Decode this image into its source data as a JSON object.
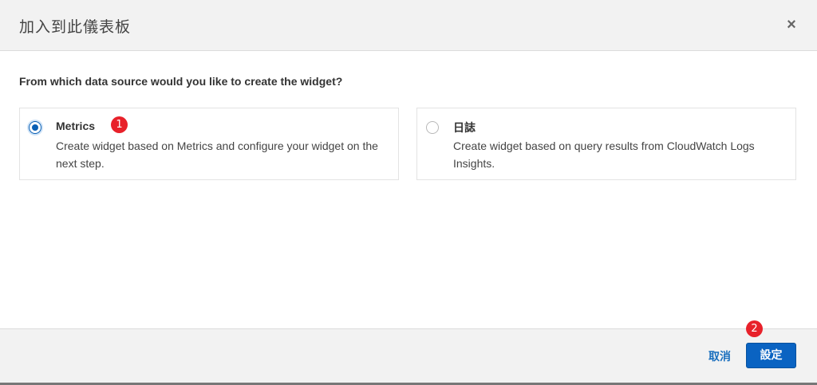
{
  "dialog": {
    "title": "加入到此儀表板",
    "close_glyph": "×"
  },
  "content": {
    "question": "From which data source would you like to create the widget?",
    "options": [
      {
        "title": "Metrics",
        "description": "Create widget based on Metrics and configure your widget on the next step.",
        "selected": true
      },
      {
        "title": "日誌",
        "description": "Create widget based on query results from CloudWatch Logs Insights.",
        "selected": false
      }
    ]
  },
  "annotations": {
    "badge1": "1",
    "badge2": "2"
  },
  "footer": {
    "cancel_label": "取消",
    "confirm_label": "設定"
  },
  "colors": {
    "accent": "#0a63c2",
    "link": "#1a6fbe",
    "badge": "#e8212a",
    "header_bg": "#f2f2f2"
  }
}
